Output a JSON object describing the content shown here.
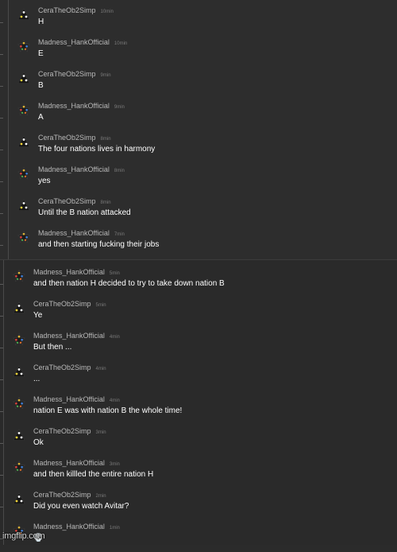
{
  "messages": [
    {
      "user": "CeraTheOb2Simp",
      "time": "10min",
      "text": "H",
      "avatar": "triangle-dots-icon"
    },
    {
      "user": "Madness_HankOfficial",
      "time": "10min",
      "text": "E",
      "avatar": "star-icon"
    },
    {
      "user": "CeraTheOb2Simp",
      "time": "9min",
      "text": "B",
      "avatar": "triangle-dots-icon"
    },
    {
      "user": "Madness_HankOfficial",
      "time": "9min",
      "text": "A",
      "avatar": "star-icon"
    },
    {
      "user": "CeraTheOb2Simp",
      "time": "8min",
      "text": "The four nations lives in harmony",
      "avatar": "triangle-dots-icon"
    },
    {
      "user": "Madness_HankOfficial",
      "time": "8min",
      "text": "yes",
      "avatar": "star-icon"
    },
    {
      "user": "CeraTheOb2Simp",
      "time": "8min",
      "text": "Until the B nation attacked",
      "avatar": "triangle-dots-icon"
    },
    {
      "user": "Madness_HankOfficial",
      "time": "7min",
      "text": "and then starting fucking their jobs",
      "avatar": "star-icon"
    },
    {
      "user": "Madness_HankOfficial",
      "time": "5min",
      "text": "and then nation H decided to try to take down nation B",
      "avatar": "star-icon"
    },
    {
      "user": "CeraTheOb2Simp",
      "time": "5min",
      "text": "Ye",
      "avatar": "triangle-dots-icon"
    },
    {
      "user": "Madness_HankOfficial",
      "time": "4min",
      "text": "But then ...",
      "avatar": "star-icon"
    },
    {
      "user": "CeraTheOb2Simp",
      "time": "4min",
      "text": "...",
      "avatar": "triangle-dots-icon"
    },
    {
      "user": "Madness_HankOfficial",
      "time": "4min",
      "text": "nation E was with nation B the whole time!",
      "avatar": "star-icon"
    },
    {
      "user": "CeraTheOb2Simp",
      "time": "3min",
      "text": "Ok",
      "avatar": "triangle-dots-icon"
    },
    {
      "user": "Madness_HankOfficial",
      "time": "3min",
      "text": "and then killled the entire nation H",
      "avatar": "star-icon"
    },
    {
      "user": "CeraTheOb2Simp",
      "time": "2min",
      "text": "Did you even watch Avitar?",
      "avatar": "triangle-dots-icon"
    },
    {
      "user": "Madness_HankOfficial",
      "time": "1min",
      "text": "💀",
      "avatar": "star-icon"
    }
  ],
  "watermark": "imgflip.com",
  "colors": {
    "background": "#2b2b2b",
    "username": "#b9b9b9",
    "message": "#ffffff",
    "timestamp": "#7a7a7a"
  }
}
